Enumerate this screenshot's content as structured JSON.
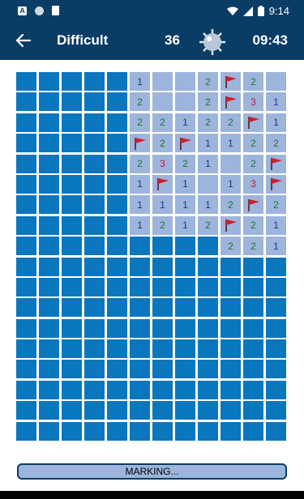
{
  "status_bar": {
    "time": "9:14"
  },
  "app_bar": {
    "back_icon": "arrow-left-icon",
    "title": "Difficult",
    "mines_remaining": "36",
    "mine_icon": "mine-icon",
    "timer": "09:43"
  },
  "colors": {
    "header": "#0a3d66",
    "covered": "#0a76bd",
    "revealed": "#9db4dc",
    "n1": "#123c8a",
    "n2": "#1c7a2c",
    "n3": "#c21a3a",
    "flag": "#cc1f2b"
  },
  "board": {
    "columns": 12,
    "rows": [
      [
        "#",
        "#",
        "#",
        "#",
        "#",
        "1",
        "",
        "",
        "2",
        "F",
        "2",
        ""
      ],
      [
        "#",
        "#",
        "#",
        "#",
        "#",
        "2",
        "",
        "",
        "2",
        "F",
        "3",
        "1"
      ],
      [
        "#",
        "#",
        "#",
        "#",
        "#",
        "2",
        "2",
        "1",
        "2",
        "2",
        "F",
        "1"
      ],
      [
        "#",
        "#",
        "#",
        "#",
        "#",
        "F",
        "2",
        "F",
        "1",
        "1",
        "2",
        "2"
      ],
      [
        "#",
        "#",
        "#",
        "#",
        "#",
        "2",
        "3",
        "2",
        "1",
        "",
        "2",
        "F"
      ],
      [
        "#",
        "#",
        "#",
        "#",
        "#",
        "1",
        "F",
        "1",
        "",
        "1",
        "3",
        "F"
      ],
      [
        "#",
        "#",
        "#",
        "#",
        "#",
        "1",
        "1",
        "1",
        "1",
        "2",
        "F",
        "2"
      ],
      [
        "#",
        "#",
        "#",
        "#",
        "#",
        "1",
        "2",
        "1",
        "2",
        "F",
        "2",
        "1"
      ],
      [
        "#",
        "#",
        "#",
        "#",
        "#",
        "#",
        "#",
        "#",
        "#",
        "2",
        "2",
        "1"
      ],
      [
        "#",
        "#",
        "#",
        "#",
        "#",
        "#",
        "#",
        "#",
        "#",
        "#",
        "#",
        "#"
      ],
      [
        "#",
        "#",
        "#",
        "#",
        "#",
        "#",
        "#",
        "#",
        "#",
        "#",
        "#",
        "#"
      ],
      [
        "#",
        "#",
        "#",
        "#",
        "#",
        "#",
        "#",
        "#",
        "#",
        "#",
        "#",
        "#"
      ],
      [
        "#",
        "#",
        "#",
        "#",
        "#",
        "#",
        "#",
        "#",
        "#",
        "#",
        "#",
        "#"
      ],
      [
        "#",
        "#",
        "#",
        "#",
        "#",
        "#",
        "#",
        "#",
        "#",
        "#",
        "#",
        "#"
      ],
      [
        "#",
        "#",
        "#",
        "#",
        "#",
        "#",
        "#",
        "#",
        "#",
        "#",
        "#",
        "#"
      ],
      [
        "#",
        "#",
        "#",
        "#",
        "#",
        "#",
        "#",
        "#",
        "#",
        "#",
        "#",
        "#"
      ],
      [
        "#",
        "#",
        "#",
        "#",
        "#",
        "#",
        "#",
        "#",
        "#",
        "#",
        "#",
        "#"
      ],
      [
        "#",
        "#",
        "#",
        "#",
        "#",
        "#",
        "#",
        "#",
        "#",
        "#",
        "#",
        "#"
      ]
    ]
  },
  "mode_button": {
    "label": "MARKING..."
  }
}
